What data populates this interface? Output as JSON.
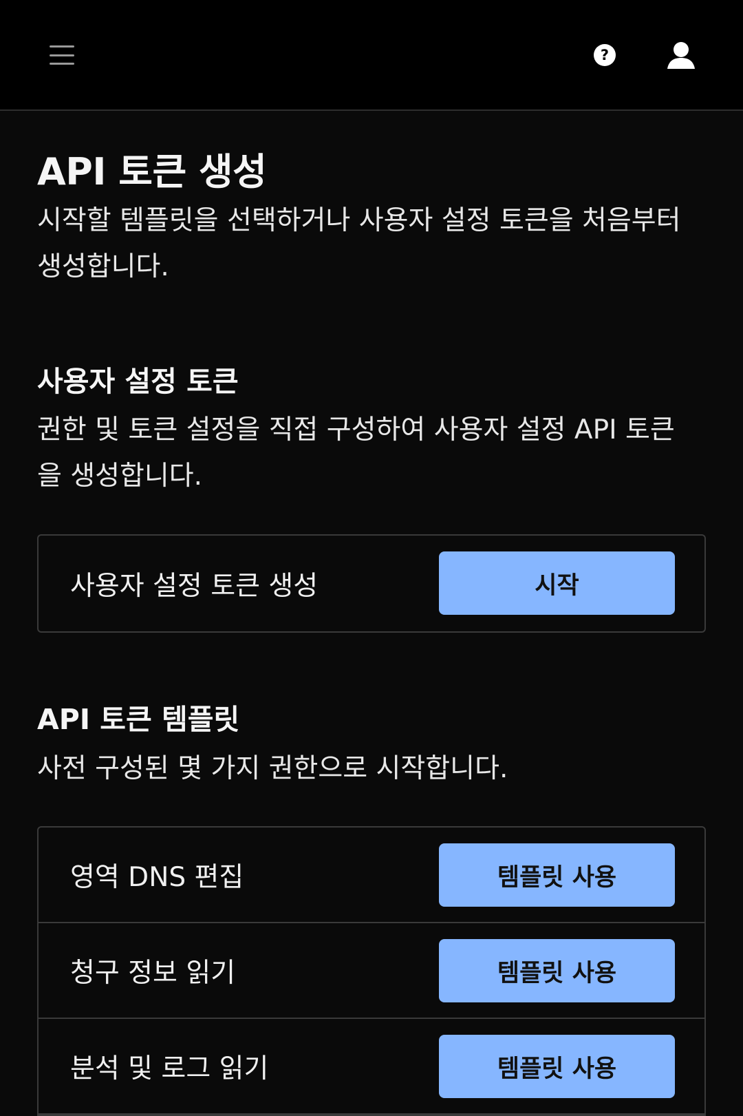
{
  "header": {
    "menu_icon": "hamburger-menu-icon",
    "help_icon": "question-circle-icon",
    "user_icon": "user-icon"
  },
  "page": {
    "title": "API 토큰 생성",
    "description": "시작할 템플릿을 선택하거나 사용자 설정 토큰을 처음부터 생성합니다."
  },
  "custom_token": {
    "title": "사용자 설정 토큰",
    "description": "권한 및 토큰 설정을 직접 구성하여 사용자 설정 API 토큰을 생성합니다.",
    "row_label": "사용자 설정 토큰 생성",
    "button_label": "시작"
  },
  "templates": {
    "title": "API 토큰 템플릿",
    "description": "사전 구성된 몇 가지 권한으로 시작합니다.",
    "items": [
      {
        "label": "영역 DNS 편집",
        "button_label": "템플릿 사용"
      },
      {
        "label": "청구 정보 읽기",
        "button_label": "템플릿 사용"
      },
      {
        "label": "분석 및 로그 읽기",
        "button_label": "템플릿 사용"
      }
    ]
  },
  "colors": {
    "background": "#0a0a0a",
    "topbar": "#000000",
    "button": "#86b6ff",
    "border": "#3a3a3a"
  }
}
